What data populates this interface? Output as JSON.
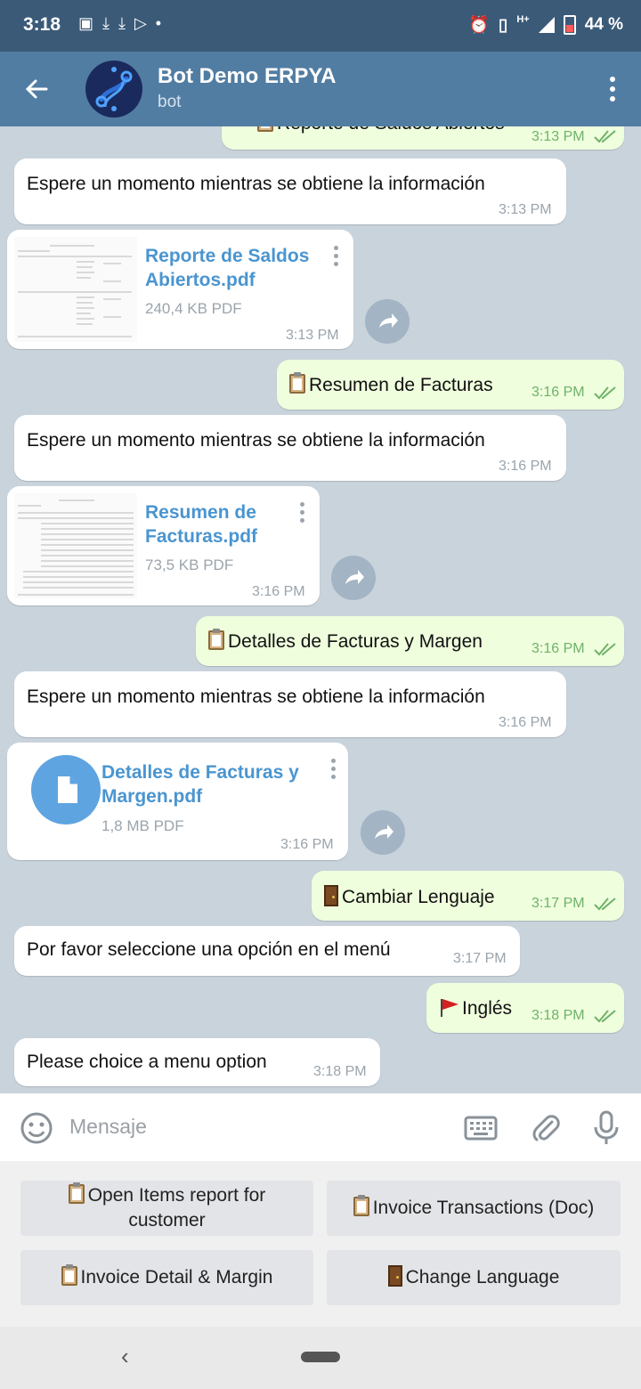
{
  "status_bar": {
    "time": "3:18",
    "network": "H+",
    "battery": "44 %",
    "left_icons": [
      "screenshot-icon",
      "download-icon",
      "download-icon",
      "play-store-icon",
      "dot-icon"
    ],
    "right_icons": [
      "alarm-icon",
      "vibrate-icon",
      "signal-icon",
      "battery-icon"
    ]
  },
  "header": {
    "title": "Bot Demo ERPYA",
    "subtitle": "bot"
  },
  "messages": [
    {
      "direction": "out",
      "type": "text",
      "text": "Reporte de Saldos Abiertos",
      "time": "3:13 PM",
      "emoji": "clipboard"
    },
    {
      "direction": "in",
      "type": "text",
      "text": "Espere un momento mientras se obtiene la información",
      "time": "3:13 PM"
    },
    {
      "direction": "in",
      "type": "file",
      "name_line1": "Reporte de Saldos",
      "name_line2": "Abiertos.pdf",
      "size": "240,4 KB PDF",
      "time": "3:13 PM"
    },
    {
      "direction": "out",
      "type": "text",
      "text": "Resumen de Facturas",
      "time": "3:16 PM",
      "emoji": "clipboard"
    },
    {
      "direction": "in",
      "type": "text",
      "text": "Espere un momento mientras se obtiene la información",
      "time": "3:16 PM"
    },
    {
      "direction": "in",
      "type": "file",
      "name_line1": "Resumen de",
      "name_line2": "Facturas.pdf",
      "size": "73,5 KB PDF",
      "time": "3:16 PM"
    },
    {
      "direction": "out",
      "type": "text",
      "text": "Detalles de Facturas y Margen",
      "time": "3:16 PM",
      "emoji": "clipboard"
    },
    {
      "direction": "in",
      "type": "text",
      "text": "Espere un momento mientras se obtiene la información",
      "time": "3:16 PM"
    },
    {
      "direction": "in",
      "type": "file",
      "name_line1": "Detalles de Facturas y",
      "name_line2": "Margen.pdf",
      "size": "1,8 MB PDF",
      "time": "3:16 PM"
    },
    {
      "direction": "out",
      "type": "text",
      "text": "Cambiar Lenguaje",
      "time": "3:17 PM",
      "emoji": "door"
    },
    {
      "direction": "in",
      "type": "text",
      "text": "Por favor seleccione una opción en el menú",
      "time": "3:17 PM"
    },
    {
      "direction": "out",
      "type": "text",
      "text": "Inglés",
      "time": "3:18 PM",
      "emoji": "flag"
    },
    {
      "direction": "in",
      "type": "text",
      "text": "Please choice a menu option",
      "time": "3:18 PM"
    }
  ],
  "input": {
    "placeholder": "Mensaje"
  },
  "bot_keyboard": [
    {
      "label_line1": "Open Items report for",
      "label_line2": "customer",
      "emoji": "clipboard"
    },
    {
      "label": "Invoice Transactions (Doc)",
      "emoji": "clipboard"
    },
    {
      "label": "Invoice Detail & Margin",
      "emoji": "clipboard"
    },
    {
      "label": "Change Language",
      "emoji": "door"
    }
  ],
  "colors": {
    "header": "#527da3",
    "status_bar": "#3a5a78",
    "chat_background": "#c9d3dc",
    "outgoing_bubble": "#effedd",
    "incoming_bubble": "#ffffff",
    "file_link": "#4a95d0"
  }
}
